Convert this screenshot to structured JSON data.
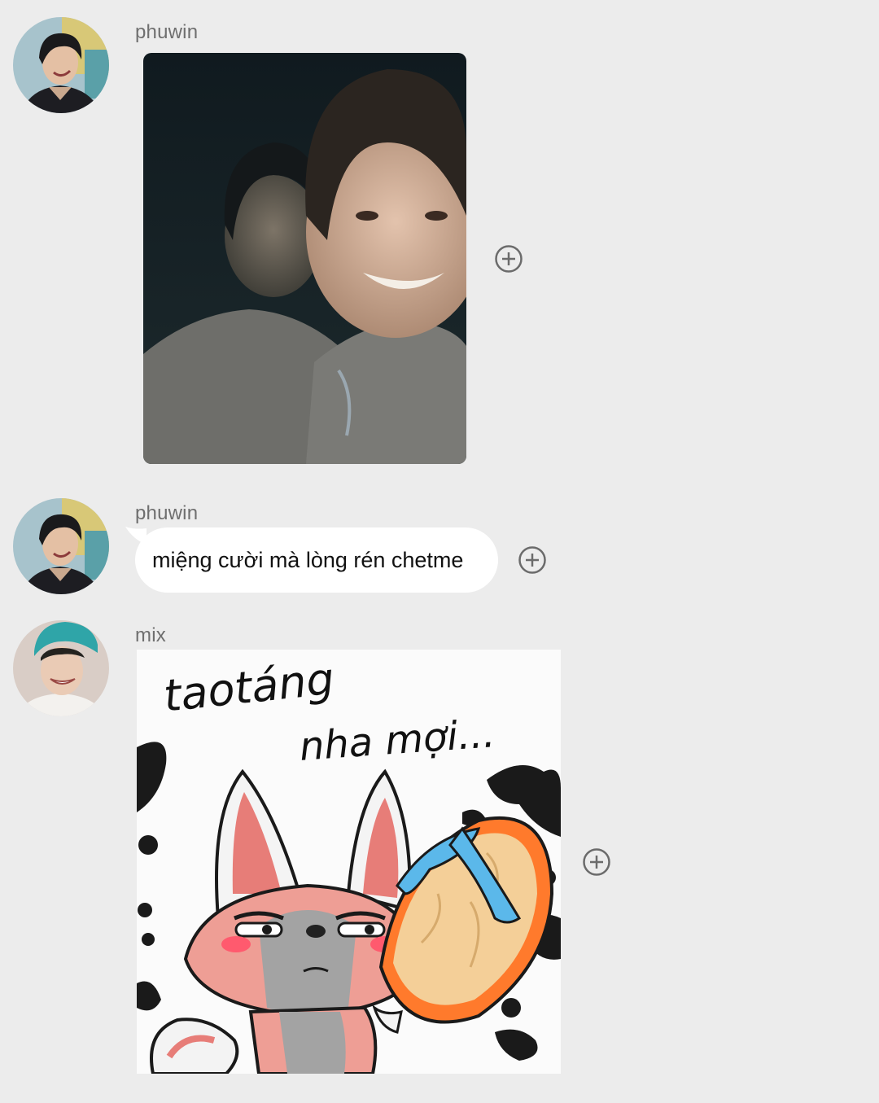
{
  "messages": [
    {
      "sender": "phuwin",
      "kind": "photo",
      "avatar_icon": "profile-avatar-phuwin",
      "reaction_icon": "add-reaction-icon"
    },
    {
      "sender": "phuwin",
      "kind": "text",
      "text": "miệng cười mà lòng rén chetme",
      "avatar_icon": "profile-avatar-phuwin",
      "reaction_icon": "add-reaction-icon"
    },
    {
      "sender": "mix",
      "kind": "sticker",
      "sticker": {
        "line1": "taotáng",
        "line2": "nha mợi..."
      },
      "avatar_icon": "profile-avatar-mix",
      "reaction_icon": "add-reaction-icon"
    }
  ],
  "colors": {
    "background": "#ececec",
    "bubble": "#ffffff",
    "sender_text": "#6f6f6f",
    "message_text": "#111111",
    "reaction_icon": "#6b6b6b"
  }
}
